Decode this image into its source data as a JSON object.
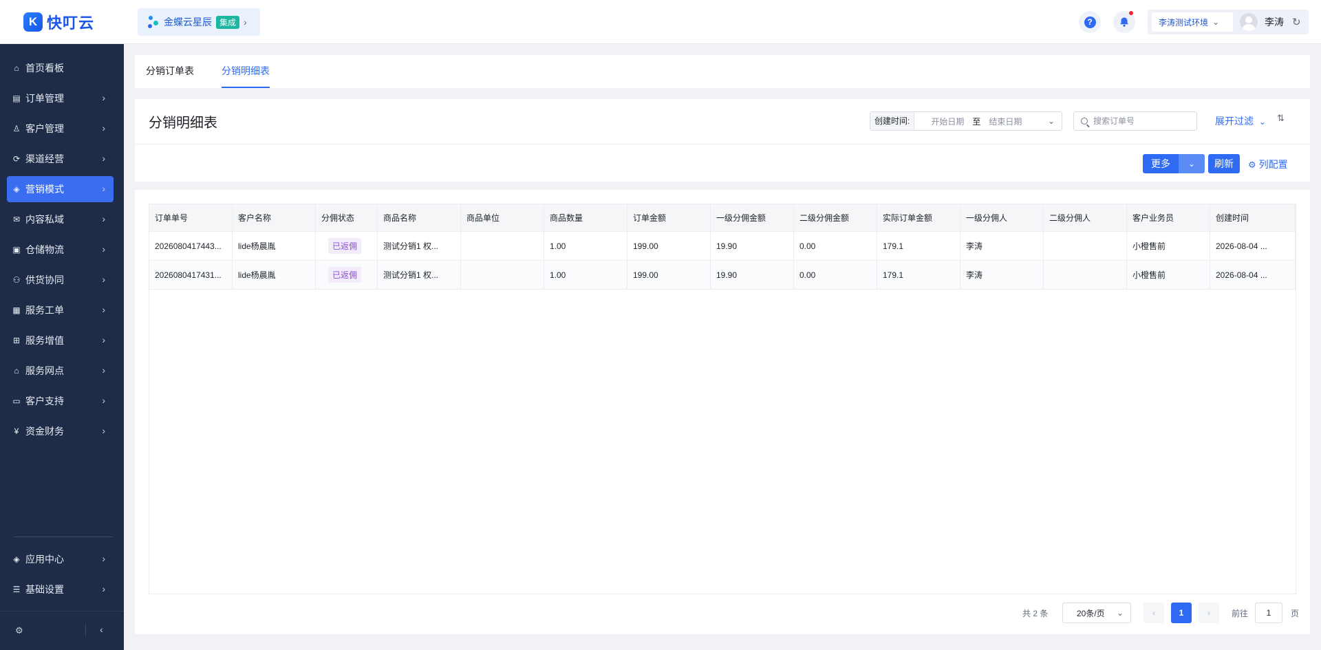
{
  "header": {
    "logo_mark": "K",
    "logo_text": "快叮云",
    "integration": {
      "name": "金蝶云星辰",
      "badge": "集成"
    },
    "env": "李涛测试环境",
    "user": "李涛"
  },
  "sidebar": {
    "items": [
      {
        "label": "首页看板",
        "icon": "home-icon",
        "glyph": "⌂",
        "arrow": false
      },
      {
        "label": "订单管理",
        "icon": "order-icon",
        "glyph": "▤",
        "arrow": true
      },
      {
        "label": "客户管理",
        "icon": "user-icon",
        "glyph": "♙",
        "arrow": true
      },
      {
        "label": "渠道经营",
        "icon": "channel-icon",
        "glyph": "⟳",
        "arrow": true
      },
      {
        "label": "营销模式",
        "icon": "marketing-icon",
        "glyph": "◈",
        "arrow": true,
        "active": true
      },
      {
        "label": "内容私域",
        "icon": "content-icon",
        "glyph": "✉",
        "arrow": true
      },
      {
        "label": "仓储物流",
        "icon": "warehouse-icon",
        "glyph": "▣",
        "arrow": true
      },
      {
        "label": "供货协同",
        "icon": "supply-icon",
        "glyph": "⚇",
        "arrow": true
      },
      {
        "label": "服务工单",
        "icon": "ticket-icon",
        "glyph": "▦",
        "arrow": true
      },
      {
        "label": "服务增值",
        "icon": "value-icon",
        "glyph": "⊞",
        "arrow": true
      },
      {
        "label": "服务网点",
        "icon": "store-icon",
        "glyph": "⌂",
        "arrow": true
      },
      {
        "label": "客户支持",
        "icon": "support-icon",
        "glyph": "▭",
        "arrow": true
      },
      {
        "label": "资金财务",
        "icon": "finance-icon",
        "glyph": "¥",
        "arrow": true
      }
    ],
    "bottom_items": [
      {
        "label": "应用中心",
        "icon": "apps-icon",
        "glyph": "◈",
        "arrow": true
      },
      {
        "label": "基础设置",
        "icon": "settings-icon",
        "glyph": "☰",
        "arrow": true
      }
    ]
  },
  "tabs": [
    {
      "label": "分销订单表",
      "active": false
    },
    {
      "label": "分销明细表",
      "active": true
    }
  ],
  "filters": {
    "title": "分销明细表",
    "date_label": "创建时间:",
    "start_placeholder": "开始日期",
    "separator": "至",
    "end_placeholder": "结束日期",
    "search_placeholder": "搜索订单号",
    "expand_label": "展开过滤",
    "more_label": "更多",
    "refresh_label": "刷新",
    "column_config_label": "列配置"
  },
  "table": {
    "columns": [
      "订单单号",
      "客户名称",
      "分佣状态",
      "商品名称",
      "商品单位",
      "商品数量",
      "订单金额",
      "一级分佣金额",
      "二级分佣金额",
      "实际订单金额",
      "一级分佣人",
      "二级分佣人",
      "客户业务员",
      "创建时间"
    ],
    "rows": [
      [
        "2026080417443...",
        "lide杨晨胤",
        "已返佣",
        "测试分销1 权...",
        "",
        "1.00",
        "199.00",
        "19.90",
        "0.00",
        "179.1",
        "李涛",
        "",
        "小橙售前",
        "2026-08-04 ..."
      ],
      [
        "2026080417431...",
        "lide杨晨胤",
        "已返佣",
        "测试分销1 权...",
        "",
        "1.00",
        "199.00",
        "19.90",
        "0.00",
        "179.1",
        "李涛",
        "",
        "小橙售前",
        "2026-08-04 ..."
      ]
    ]
  },
  "pagination": {
    "total_text": "共 2 条",
    "page_size": "20条/页",
    "current_page": "1",
    "goto_label": "前往",
    "goto_value": "1",
    "page_suffix": "页"
  }
}
